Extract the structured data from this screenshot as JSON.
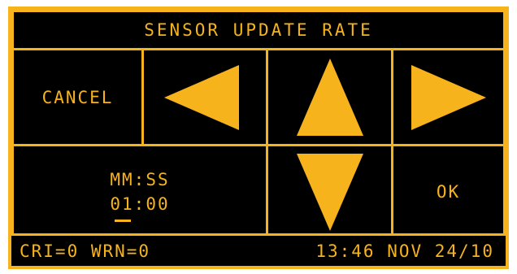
{
  "header": {
    "title": "SENSOR UPDATE RATE"
  },
  "buttons": {
    "cancel_label": "CANCEL",
    "ok_label": "OK"
  },
  "time_field": {
    "format_label": "MM:SS",
    "minutes": "01",
    "separator": ":",
    "seconds": "00"
  },
  "status_bar": {
    "alerts": "CRI=0 WRN=0",
    "datetime": "13:46 NOV 24/10"
  },
  "icons": {
    "left": "arrow-left-icon",
    "up": "arrow-up-icon",
    "right": "arrow-right-icon",
    "down": "arrow-down-icon"
  },
  "colors": {
    "accent": "#f7b31c",
    "background": "#000000"
  }
}
